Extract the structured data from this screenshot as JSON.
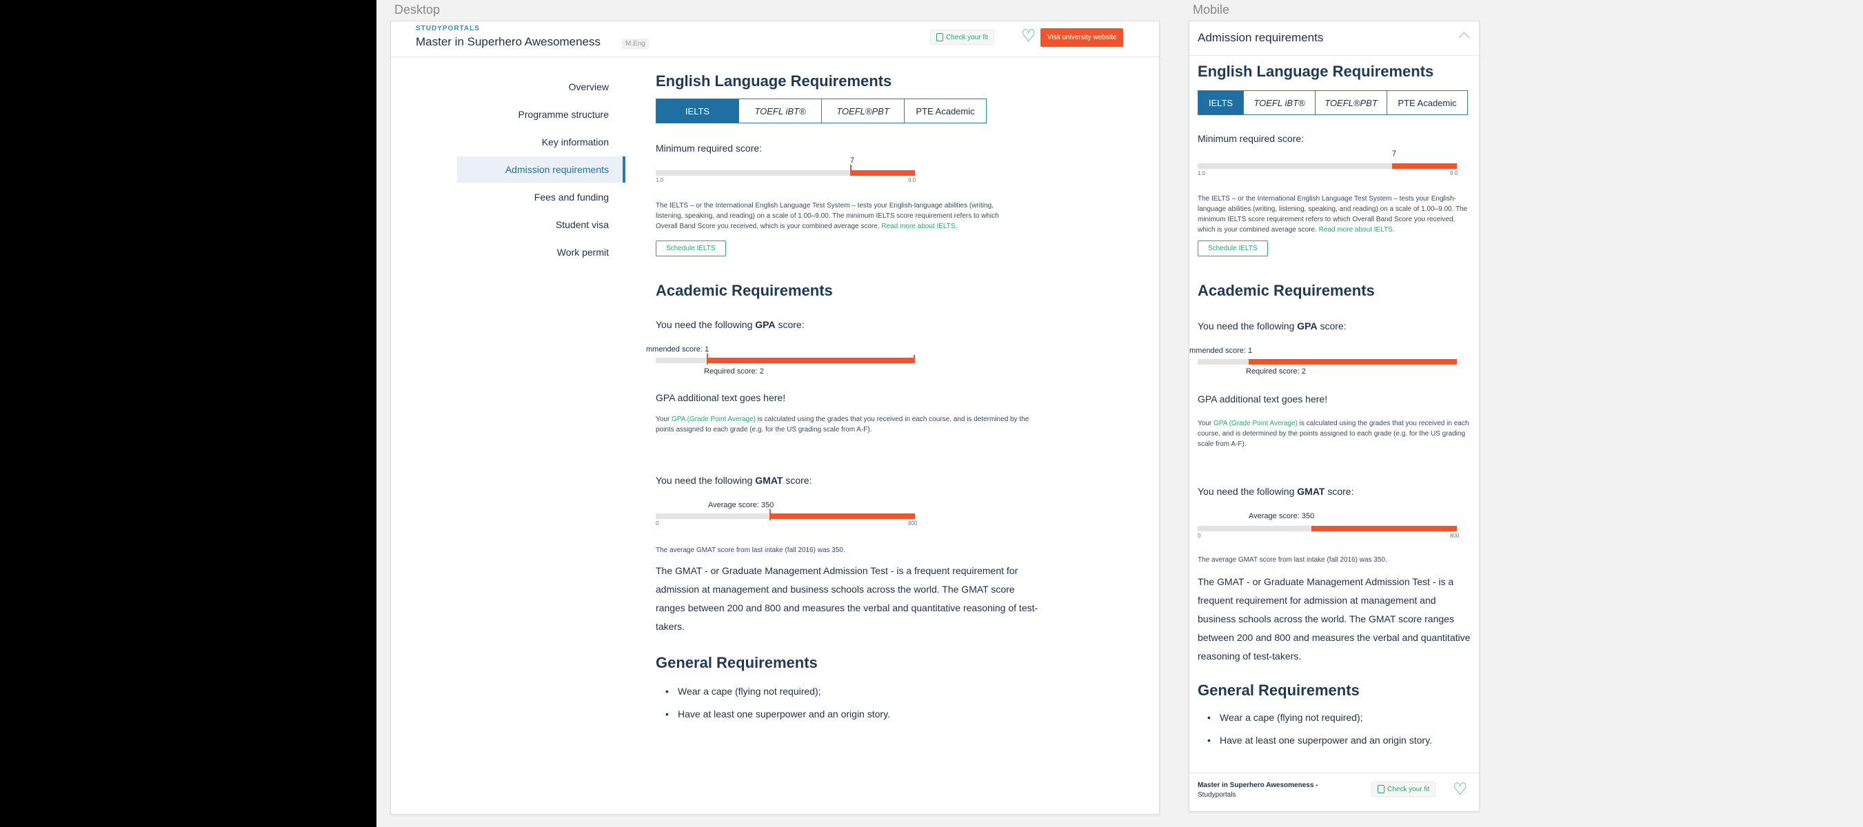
{
  "canvas": {
    "desktop_label": "Desktop",
    "mobile_label": "Mobile"
  },
  "header": {
    "brand": "STUDYPORTALS",
    "programme": "Master in Superhero Awesomeness",
    "degree": "M.Eng",
    "check_fit": "Check your fit",
    "visit": "Visit university website"
  },
  "nav": {
    "items": [
      {
        "label": "Overview"
      },
      {
        "label": "Programme structure"
      },
      {
        "label": "Key information"
      },
      {
        "label": "Admission requirements",
        "active": true
      },
      {
        "label": "Fees and funding"
      },
      {
        "label": "Student visa"
      },
      {
        "label": "Work permit"
      }
    ]
  },
  "english": {
    "title": "English Language Requirements",
    "tabs": [
      "IELTS",
      "TOEFL iBT®",
      "TOEFL®PBT",
      "PTE Academic"
    ],
    "active_tab": 0,
    "min_label": "Minimum required score:",
    "score": {
      "value": 7,
      "value_label": "7",
      "min": 1.0,
      "max": 9.0,
      "min_label": "1.0",
      "max_label": "9.0"
    },
    "desc": "The IELTS – or the International English Language Test System – tests your English-language abilities (writing, listening, speaking, and reading) on a scale of 1.00–9.00. The minimum IELTS score requirement refers to which Overall Band Score you received, which is your combined average score.",
    "link": "Read more about IELTS.",
    "schedule": "Schedule IELTS"
  },
  "academic": {
    "title": "Academic Requirements",
    "gpa_prefix": "You need the following ",
    "gpa_bold": "GPA",
    "gpa_suffix": " score:",
    "gpa_recommended": "mmended score: 1",
    "gpa_required": "Required score: 2",
    "gpa_additional": "GPA additional text goes here!",
    "gpa_desc_pre": "Your ",
    "gpa_desc_link": "GPA (Grade Point Average)",
    "gpa_desc_post": " is calculated using the grades that you received in each course, and is determined by the points assigned to each grade (e.g. for the US grading scale from A-F).",
    "gmat_prefix": "You need the following ",
    "gmat_bold": "GMAT",
    "gmat_suffix": " score:",
    "gmat_average": "Average score: 350",
    "gmat": {
      "value": 350,
      "min": 0,
      "max": 800,
      "min_label": "0",
      "max_label": "800"
    },
    "gmat_note": "The average GMAT score from last intake (fall 2016) was 350.",
    "gmat_desc": "The GMAT - or Graduate Management Admission Test - is a frequent requirement for admission at management and business schools across the world. The GMAT score ranges between 200 and 800 and measures the verbal and quantitative reasoning of test-takers."
  },
  "general": {
    "title": "General Requirements",
    "items": [
      "Wear a cape (flying not required);",
      "Have at least one superpower and an origin story."
    ]
  },
  "mobile": {
    "section": "Admission requirements",
    "footer_title": "Master in Superhero Awesomeness -",
    "footer_sub": "Studyportals"
  },
  "colors": {
    "accent": "#1f6fa3",
    "bar": "#f0542d",
    "green": "#29a86b"
  }
}
